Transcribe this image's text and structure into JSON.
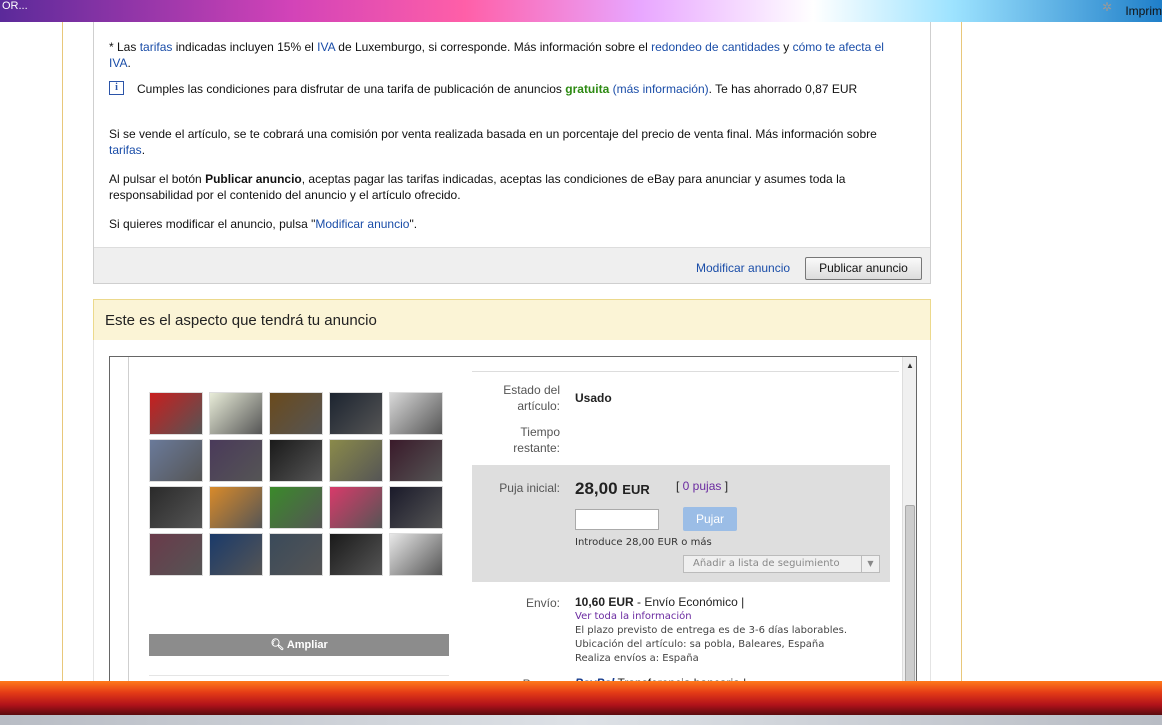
{
  "window": {
    "top_left": "OR...",
    "top_right": "Imprim"
  },
  "info": {
    "p1_prefix": "* Las ",
    "p1_tarifas": "tarifas",
    "p1_mid": " indicadas incluyen 15% el ",
    "p1_iva": "IVA",
    "p1_mid2": " de Luxemburgo, si corresponde. Más información sobre el ",
    "p1_redondeo": "redondeo de cantidades",
    "p1_and": " y ",
    "p1_como": "cómo te afecta el IVA",
    "p1_end": ".",
    "notice_prefix": "Cumples las condiciones para disfrutar de una tarifa de publicación de anuncios ",
    "notice_gratuita": "gratuita",
    "notice_mas": "(más información)",
    "notice_end": ". Te has ahorrado 0,87 EUR",
    "p2_text": "Si se vende el artículo, se te cobrará una comisión por venta realizada basada en un porcentaje del precio de venta final. Más información sobre ",
    "p2_tarifas": "tarifas",
    "p2_end": ".",
    "p3_prefix": "Al pulsar el botón ",
    "p3_bold": "Publicar anuncio",
    "p3_text": ", aceptas pagar las tarifas indicadas, aceptas las condiciones de eBay para anunciar y asumes toda la responsabilidad por el contenido del anuncio y el artículo ofrecido.",
    "p4_prefix": "Si quieres modificar el anuncio, pulsa \"",
    "p4_link": "Modificar anuncio",
    "p4_end": "\".",
    "modify_link": "Modificar anuncio",
    "publish_button": "Publicar anuncio"
  },
  "preview": {
    "header": "Este es el aspecto que tendrá tu anuncio",
    "ampliar": "Ampliar",
    "thumb_colors": [
      [
        "#c81e1e",
        "#e8ecd8",
        "#6a4a1c",
        "#1c2430",
        "#d8d8d8"
      ],
      [
        "#6a7a9a",
        "#4a3a5a",
        "#1a1a1a",
        "#8a8a4a",
        "#3a1a2a"
      ],
      [
        "#2a2a2a",
        "#d88a2a",
        "#3a8a2a",
        "#d83a6a",
        "#1a1a2a"
      ],
      [
        "#6a3a4a",
        "#1a3a6a",
        "#3a4a5a",
        "#1a1a1a",
        "#e8e8e8"
      ]
    ],
    "estado_label": "Estado del artículo:",
    "estado_value": "Usado",
    "tiempo_label": "Tiempo restante:",
    "puja_label": "Puja inicial:",
    "price_amount": "28,00",
    "price_currency": "EUR",
    "pujas_open": "[ ",
    "pujas_link": "0 pujas",
    "pujas_close": " ]",
    "bid_button": "Pujar",
    "min_bid": "Introduce 28,00 EUR o más",
    "watch_button": "Añadir a lista de seguimiento",
    "envio_label": "Envío:",
    "envio_price": "10,60 EUR",
    "envio_type": " - Envío Económico  |",
    "ver_info": "Ver toda la información",
    "plazo": "El plazo previsto de entrega es de 3-6 días laborables.",
    "ubicacion": "Ubicación del artículo: sa pobla, Baleares, España",
    "realiza": "Realiza envíos a: España",
    "pagos_label": "Pagos:",
    "paypal": "PayPal",
    "transferencia": " Transferencia bancaria |"
  }
}
